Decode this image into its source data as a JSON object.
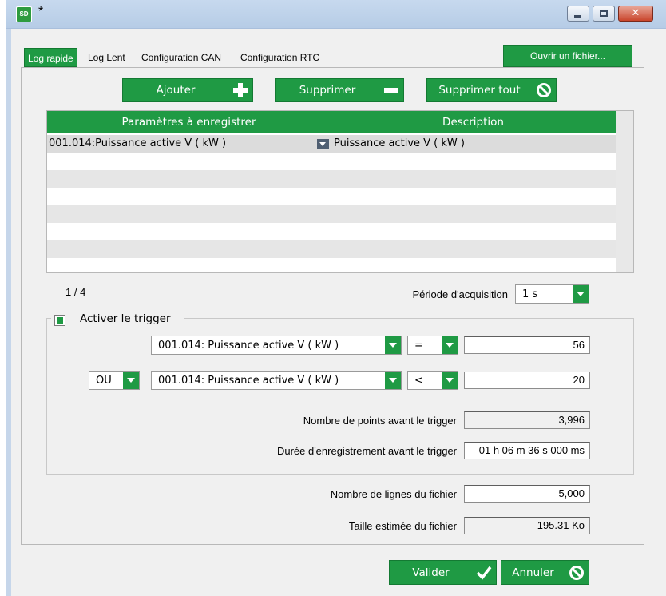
{
  "window": {
    "title": "*",
    "icon_text": "SD",
    "controls": {
      "minimize": "minimize-icon",
      "maximize": "maximize-icon",
      "close": "close-icon",
      "close_glyph": "✕"
    }
  },
  "tabs": [
    {
      "label": "Log rapide",
      "active": true
    },
    {
      "label": "Log Lent",
      "active": false
    },
    {
      "label": "Configuration CAN",
      "active": false
    },
    {
      "label": "Configuration RTC",
      "active": false
    }
  ],
  "open_file_button": "Ouvrir un fichier...",
  "toolbar": {
    "add_label": "Ajouter",
    "remove_label": "Supprimer",
    "remove_all_label": "Supprimer tout"
  },
  "table": {
    "headers": [
      "Paramètres à enregistrer",
      "Description"
    ],
    "rows": [
      {
        "param": "001.014:Puissance active V ( kW )",
        "description": "Puissance active V ( kW )"
      }
    ]
  },
  "pagination": "1 / 4",
  "acquisition": {
    "label": "Période d'acquisition",
    "value": "1 s"
  },
  "trigger": {
    "enable_label": "Activer le trigger",
    "enabled": true,
    "conditions": [
      {
        "param": "001.014: Puissance active V ( kW )",
        "operator": "=",
        "value": "56"
      },
      {
        "logic": "OU",
        "param": "001.014: Puissance active V ( kW )",
        "operator": "<",
        "value": "20"
      }
    ],
    "points_before_label": "Nombre de points avant le trigger",
    "points_before_value": "3,996",
    "duration_before_label": "Durée d'enregistrement avant le trigger",
    "duration_before_value": "01 h 06 m 36 s 000 ms"
  },
  "file": {
    "lines_label": "Nombre de lignes du fichier",
    "lines_value": "5,000",
    "size_label": "Taille estimée du fichier",
    "size_value": "195.31 Ko"
  },
  "footer": {
    "validate_label": "Valider",
    "cancel_label": "Annuler"
  },
  "colors": {
    "accent": "#1f9a44",
    "accent_dark": "#147a33"
  }
}
